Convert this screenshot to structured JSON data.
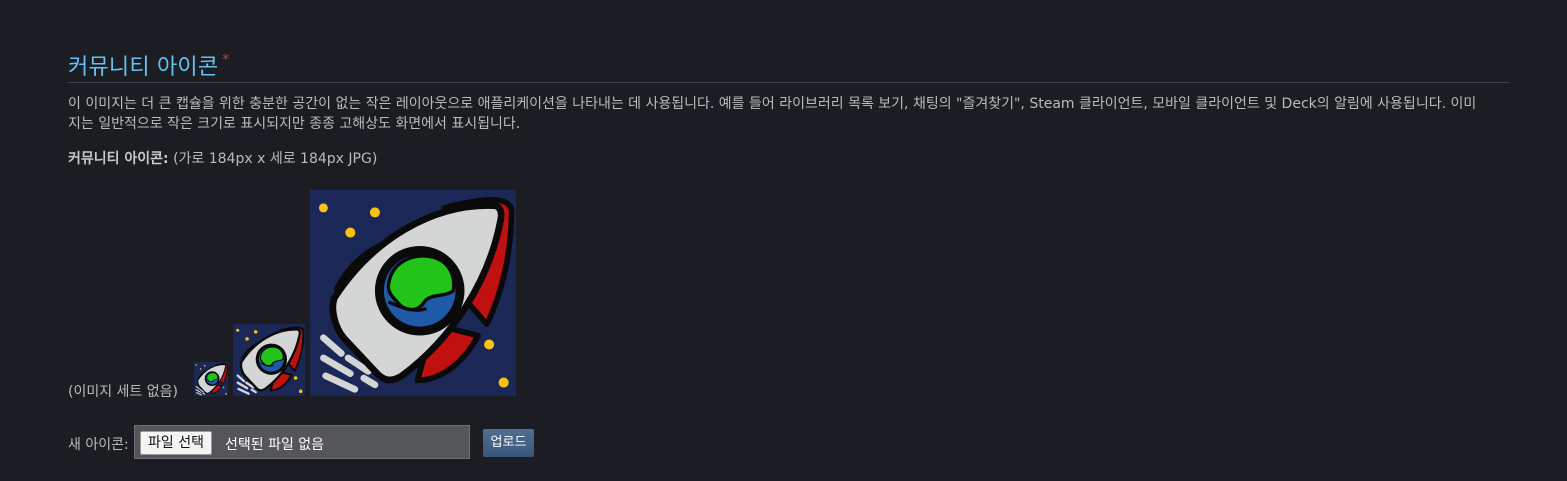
{
  "section": {
    "title": "커뮤니티 아이콘",
    "required_mark": "*",
    "description": "이 이미지는 더 큰 캡슐을 위한 충분한 공간이 없는 작은 레이아웃으로 애플리케이션을 나타내는 데 사용됩니다. 예를 들어 라이브러리 목록 보기, 채팅의 \"즐겨찾기\", Steam 클라이언트, 모바일 클라이언트 및 Deck의 알림에 사용됩니다. 이미지는 일반적으로 작은 크기로 표시되지만 종종 고해상도 화면에서 표시됩니다.",
    "spec_label": "커뮤니티 아이콘:",
    "spec_value": "(가로 184px x 세로 184px JPG)"
  },
  "preview": {
    "no_set_text": "(이미지 세트 없음)",
    "icon_name": "rocket-icon",
    "colors": {
      "background": "#1b2857",
      "hull": "#d4d6d6",
      "fin": "#c0100f",
      "earth_land": "#22c41a",
      "earth_sea": "#1e5aa8",
      "star": "#f7c313",
      "outline": "#0a0a0a"
    }
  },
  "upload": {
    "new_icon_label": "새 아이콘:",
    "choose_file_label": "파일 선택",
    "no_file_text": "선택된 파일 없음",
    "upload_label": "업로드"
  }
}
